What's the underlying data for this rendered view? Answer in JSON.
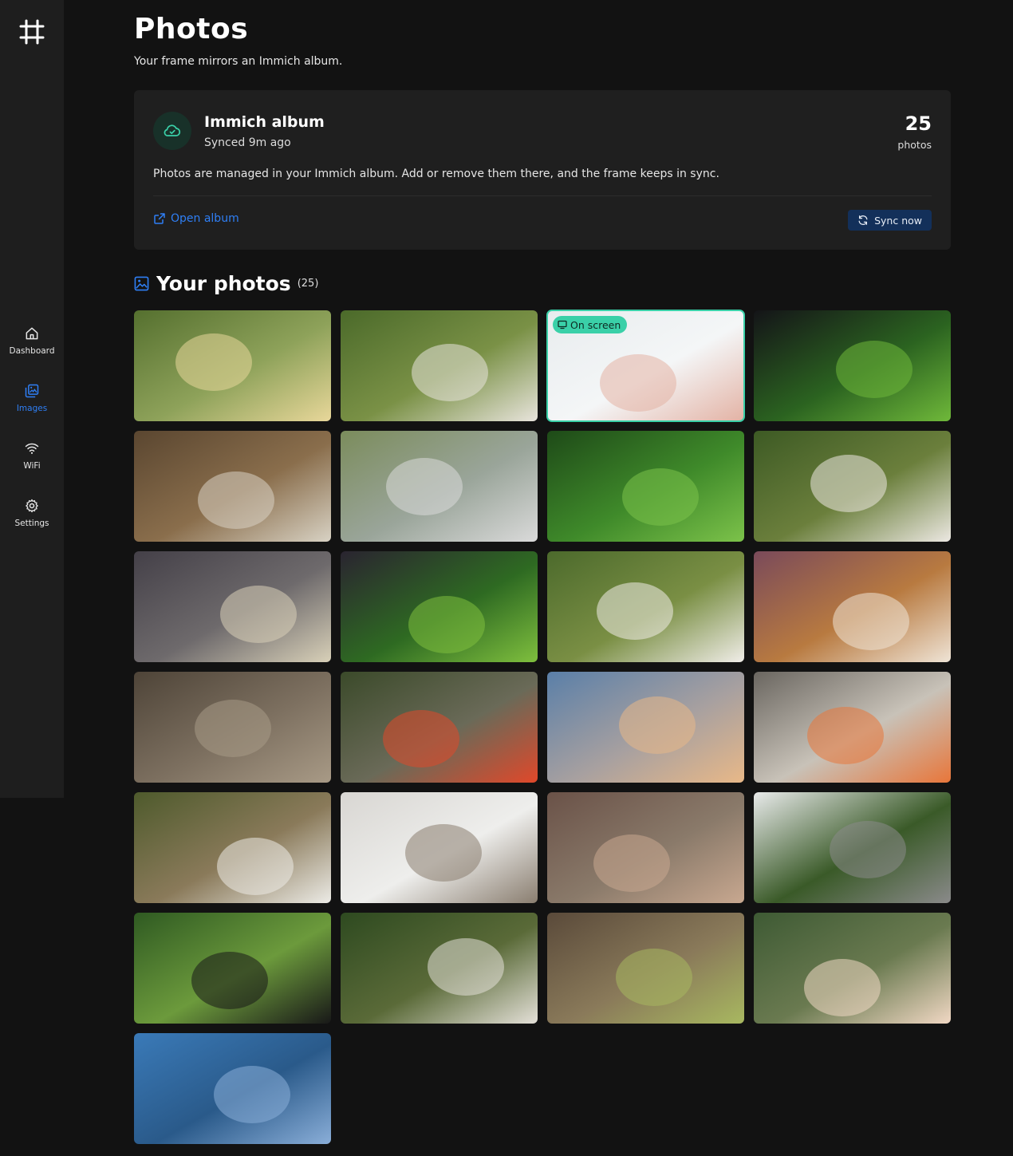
{
  "sidebar": {
    "logo_icon": "frame-grid-icon",
    "items": [
      {
        "label": "Dashboard",
        "icon": "home-icon",
        "active": false
      },
      {
        "label": "Images",
        "icon": "images-icon",
        "active": true
      },
      {
        "label": "WiFi",
        "icon": "wifi-icon",
        "active": false
      },
      {
        "label": "Settings",
        "icon": "gear-icon",
        "active": false
      }
    ]
  },
  "header": {
    "title": "Photos",
    "subtitle": "Your frame mirrors an Immich album."
  },
  "album": {
    "name": "Immich album",
    "synced": "Synced 9m ago",
    "count": "25",
    "count_label": "photos",
    "description": "Photos are managed in your Immich album. Add or remove them there, and the frame keeps in sync.",
    "open_label": "Open album",
    "sync_label": "Sync now",
    "icon": "cloud-sync-icon"
  },
  "photos_section": {
    "title": "Your photos",
    "count": "(25)",
    "icon": "image-icon"
  },
  "badge": {
    "label": "On screen",
    "icon": "monitor-icon"
  },
  "photos": [
    {
      "name": "photo-flower-yellow",
      "palette": [
        "#55702f",
        "#8ea25a",
        "#e8d79a"
      ]
    },
    {
      "name": "photo-dog-grass",
      "palette": [
        "#4b6a2a",
        "#7a9146",
        "#e8e4dc"
      ]
    },
    {
      "name": "photo-baby-feet",
      "palette": [
        "#e8ecee",
        "#f4f6f7",
        "#e3b2a4"
      ],
      "on_screen": true
    },
    {
      "name": "photo-aquarium",
      "palette": [
        "#141418",
        "#2b6320",
        "#6fb83a"
      ]
    },
    {
      "name": "photo-lemur",
      "palette": [
        "#5a4630",
        "#8a6e4c",
        "#d8d2c4"
      ]
    },
    {
      "name": "photo-cattle",
      "palette": [
        "#7b8c5c",
        "#9aa59a",
        "#dadada"
      ]
    },
    {
      "name": "photo-aquarium-plants",
      "palette": [
        "#1e4a18",
        "#3f8a2a",
        "#7cc24a"
      ]
    },
    {
      "name": "photo-dog-closeup",
      "palette": [
        "#3d5a24",
        "#6b7f3c",
        "#ece8e2"
      ]
    },
    {
      "name": "photo-cat-sofa",
      "palette": [
        "#444048",
        "#6e6a6c",
        "#d8d0b8"
      ]
    },
    {
      "name": "photo-aquarium-fish",
      "palette": [
        "#2a2430",
        "#2e6a22",
        "#7fbf3e"
      ]
    },
    {
      "name": "photo-dog-white",
      "palette": [
        "#4c6a2c",
        "#7a8f44",
        "#f0ede8"
      ]
    },
    {
      "name": "photo-guinea-pig",
      "palette": [
        "#7a4a5a",
        "#b87a40",
        "#efe4d6"
      ]
    },
    {
      "name": "photo-lizard",
      "palette": [
        "#4e4438",
        "#7d7060",
        "#a89a86"
      ]
    },
    {
      "name": "photo-red-flowers",
      "palette": [
        "#3b4a2a",
        "#6a6a58",
        "#e0482a"
      ]
    },
    {
      "name": "photo-airplane-wing",
      "palette": [
        "#5a7fa8",
        "#a7a0a0",
        "#e8b888"
      ]
    },
    {
      "name": "photo-cat-sleeping",
      "palette": [
        "#6a6660",
        "#c8c2b8",
        "#e8763a"
      ]
    },
    {
      "name": "photo-dog-path",
      "palette": [
        "#4e5a2c",
        "#8a7a5a",
        "#ecebe6"
      ]
    },
    {
      "name": "photo-kitten",
      "palette": [
        "#d8d6d2",
        "#eeeeec",
        "#8a7e70"
      ]
    },
    {
      "name": "photo-cat-bed",
      "palette": [
        "#6a5248",
        "#8a7a6a",
        "#c8a890"
      ]
    },
    {
      "name": "photo-koala",
      "palette": [
        "#e8eaea",
        "#3a5a28",
        "#8a8a8a"
      ]
    },
    {
      "name": "photo-moth-leaf",
      "palette": [
        "#2f5a22",
        "#6c9a3c",
        "#181818"
      ]
    },
    {
      "name": "photo-dog-profile",
      "palette": [
        "#2e4a20",
        "#5a6a38",
        "#e4e0d8"
      ]
    },
    {
      "name": "photo-panda",
      "palette": [
        "#5a4a3a",
        "#8a7a5a",
        "#a8b860"
      ]
    },
    {
      "name": "photo-bee-flower",
      "palette": [
        "#3e5a34",
        "#6a7a50",
        "#f1d8c4"
      ]
    },
    {
      "name": "photo-coast-view",
      "palette": [
        "#3a7ab8",
        "#2a5a8a",
        "#8aaed8"
      ]
    }
  ]
}
